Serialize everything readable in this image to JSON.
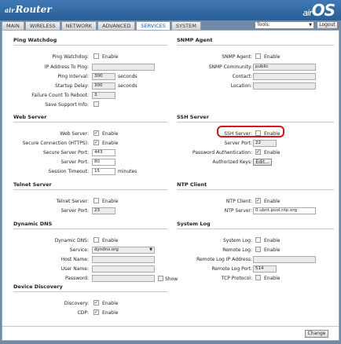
{
  "header": {
    "brand_prefix": "air",
    "brand": "Router",
    "logo_prefix": "air",
    "logo": "OS"
  },
  "tabs": [
    "MAIN",
    "WIRELESS",
    "NETWORK",
    "ADVANCED",
    "SERVICES",
    "SYSTEM"
  ],
  "toolbar": {
    "tools": "Tools:",
    "logout": "Logout"
  },
  "ping": {
    "title": "Ping Watchdog",
    "watchdog_label": "Ping Watchdog:",
    "enable": "Enable",
    "ip_label": "IP Address To Ping:",
    "ip_value": "",
    "interval_label": "Ping Interval:",
    "interval_value": "300",
    "interval_unit": "seconds",
    "delay_label": "Startup Delay:",
    "delay_value": "300",
    "delay_unit": "seconds",
    "fail_label": "Failure Count To Reboot:",
    "fail_value": "3",
    "support_label": "Save Support Info:"
  },
  "snmp": {
    "title": "SNMP Agent",
    "agent_label": "SNMP Agent:",
    "enable": "Enable",
    "community_label": "SNMP Community:",
    "community_value": "public",
    "contact_label": "Contact:",
    "contact_value": "",
    "location_label": "Location:",
    "location_value": ""
  },
  "web": {
    "title": "Web Server",
    "server_label": "Web Server:",
    "enable": "Enable",
    "secure_label": "Secure Connection (HTTPS):",
    "secure_port_label": "Secure Server Port:",
    "secure_port_value": "443",
    "port_label": "Server Port:",
    "port_value": "80",
    "timeout_label": "Session Timeout:",
    "timeout_value": "15",
    "timeout_unit": "minutes"
  },
  "ssh": {
    "title": "SSH Server",
    "server_label": "SSH Server:",
    "enable": "Enable",
    "port_label": "Server Port:",
    "port_value": "22",
    "auth_label": "Password Authentication:",
    "keys_label": "Authorized Keys:",
    "keys_button": "Edit..."
  },
  "telnet": {
    "title": "Telnet Server",
    "server_label": "Telnet Server:",
    "enable": "Enable",
    "port_label": "Server Port:",
    "port_value": "23"
  },
  "ntp": {
    "title": "NTP Client",
    "client_label": "NTP Client:",
    "enable": "Enable",
    "server_label": "NTP Server:",
    "server_value": "0.ubnt.pool.ntp.org"
  },
  "ddns": {
    "title": "Dynamic DNS",
    "label": "Dynamic DNS:",
    "enable": "Enable",
    "service_label": "Service:",
    "service_value": "dyndns.org",
    "host_label": "Host Name:",
    "user_label": "User Name:",
    "password_label": "Password:",
    "show_label": "Show"
  },
  "syslog": {
    "title": "System Log",
    "log_label": "System Log:",
    "enable": "Enable",
    "remote_label": "Remote Log:",
    "remote_ip_label": "Remote Log IP Address:",
    "remote_port_label": "Remote Log Port:",
    "remote_port_value": "514",
    "tcp_label": "TCP Protocol:"
  },
  "discovery": {
    "title": "Device Discovery",
    "discovery_label": "Discovery:",
    "enable": "Enable",
    "cdp_label": "CDP:"
  },
  "footer": {
    "change": "Change"
  },
  "colors": {
    "header": "#2a5f97",
    "highlight": "#d8141c",
    "background": "#6f8ba8"
  }
}
